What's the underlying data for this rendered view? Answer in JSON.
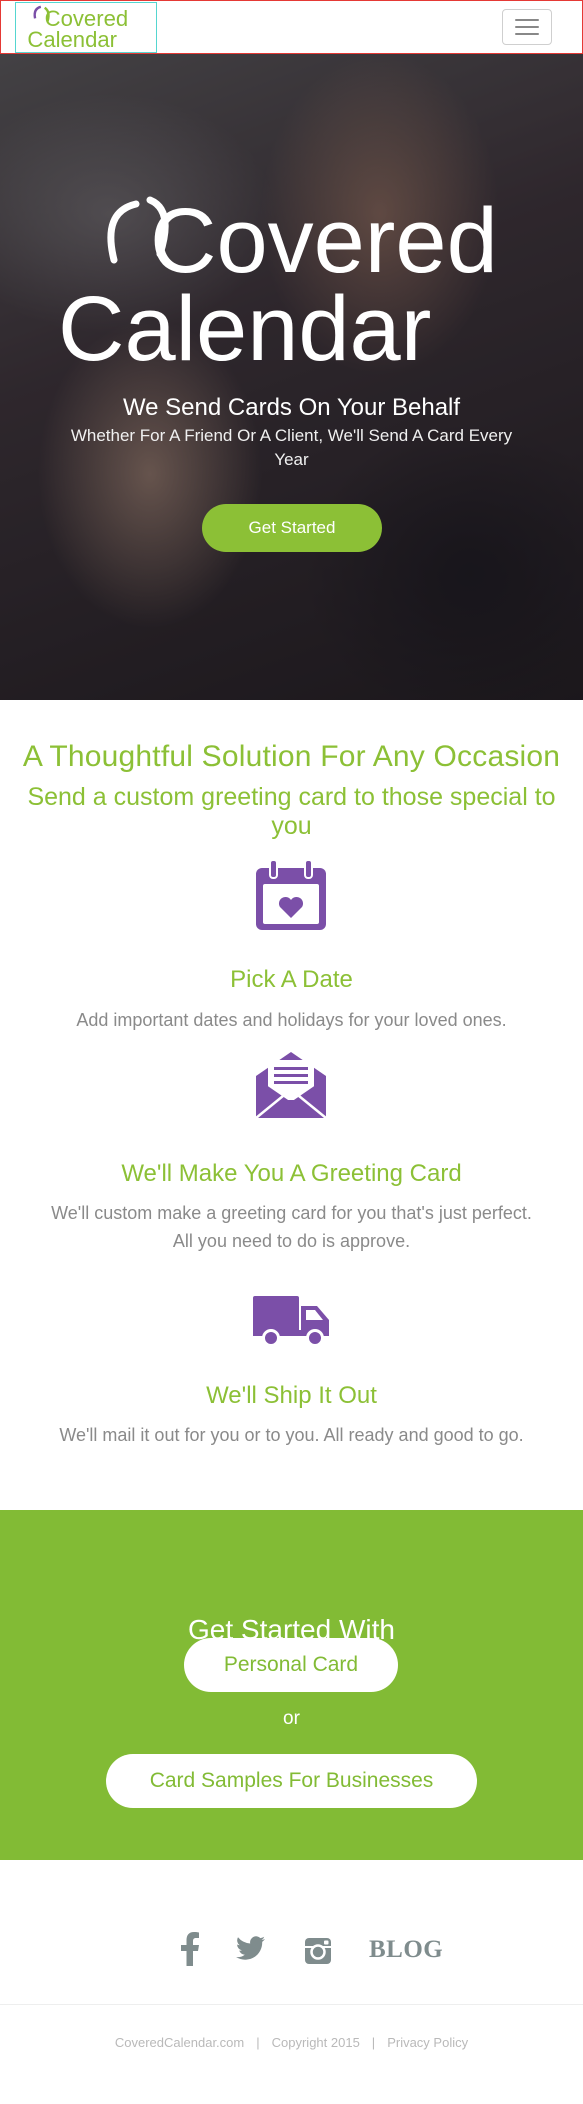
{
  "brand": {
    "line1": "Covered",
    "line2": "Calendar"
  },
  "hero": {
    "tagline": "We Send Cards On Your Behalf",
    "subtitle": "Whether For A Friend Or A Client, We'll Send A Card Every Year",
    "button_label": "Get Started"
  },
  "how": {
    "title": "A Thoughtful Solution For Any Occasion",
    "subtitle": "Send a custom greeting card to those special to you",
    "steps": [
      {
        "icon": "calendar-heart-icon",
        "title": "Pick A Date",
        "desc": "Add important dates and holidays for your loved ones."
      },
      {
        "icon": "open-envelope-icon",
        "title": "We'll Make You A Greeting Card",
        "desc": "We'll custom make a greeting card for you that's just perfect. All you need to do is approve."
      },
      {
        "icon": "delivery-truck-icon",
        "title": "We'll Ship It Out",
        "desc": "We'll mail it out for you or to you. All ready and good to go."
      }
    ]
  },
  "cta": {
    "title": "Get Started With",
    "personal_label": "Personal Card",
    "or_label": "or",
    "business_label": "Card Samples For Businesses"
  },
  "footer": {
    "blog_label": "BLOG",
    "site": "CoveredCalendar.com",
    "copyright": "Copyright 2015",
    "privacy": "Privacy Policy",
    "separator": "|"
  },
  "colors": {
    "accent": "#8cc036",
    "cta_bg": "#82bb35",
    "icon_purple": "#7b4fa8",
    "social_gray": "#7f8c8d"
  }
}
